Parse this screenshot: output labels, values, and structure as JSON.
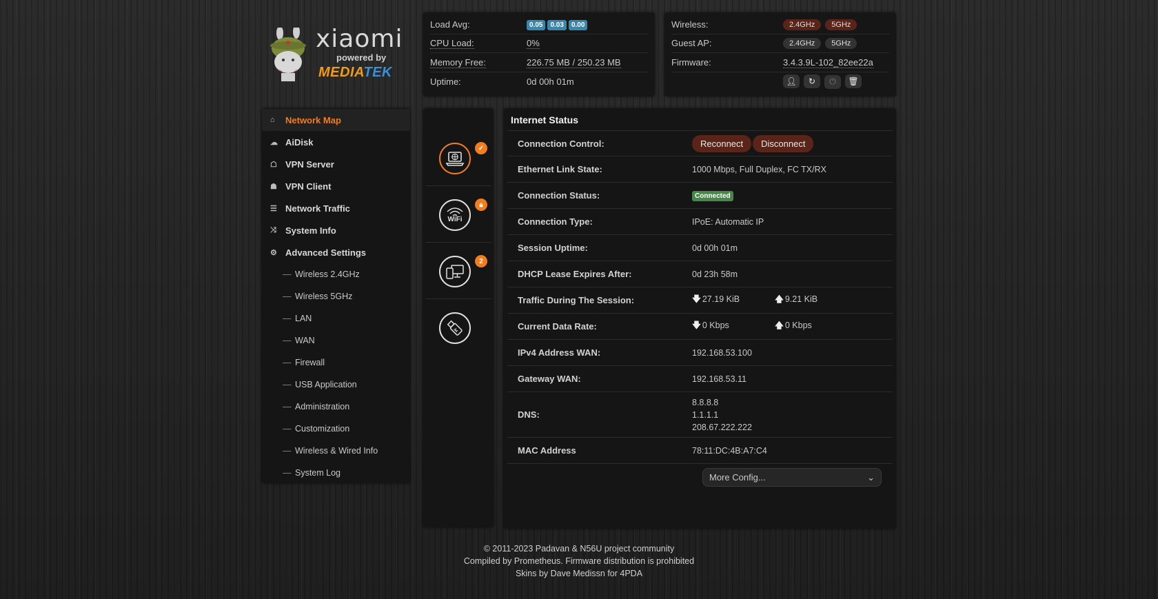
{
  "logo": {
    "brand": "xiaomi",
    "powered": "powered by",
    "mediatek_a": "MEDIA",
    "mediatek_b": "TEK"
  },
  "system": {
    "load_avg_label": "Load Avg:",
    "load_avg": [
      "0.05",
      "0.03",
      "0.00"
    ],
    "cpu_label": "CPU Load:",
    "cpu_value": "0%",
    "mem_label": "Memory Free:",
    "mem_value": "226.75 MB / 250.23 MB",
    "uptime_label": "Uptime:",
    "uptime_value": "0d 00h 01m"
  },
  "wireless": {
    "wireless_label": "Wireless:",
    "wireless_24": "2.4GHz",
    "wireless_5": "5GHz",
    "guest_label": "Guest AP:",
    "guest_24": "2.4GHz",
    "guest_5": "5GHz",
    "firmware_label": "Firmware:",
    "firmware_value": "3.4.3.9L-102_82ee22a"
  },
  "sidebar": {
    "items": [
      {
        "label": "Network Map",
        "icon": "home-icon"
      },
      {
        "label": "AiDisk",
        "icon": "cloud-icon"
      },
      {
        "label": "VPN Server",
        "icon": "server-icon"
      },
      {
        "label": "VPN Client",
        "icon": "client-icon"
      },
      {
        "label": "Network Traffic",
        "icon": "list-icon"
      },
      {
        "label": "System Info",
        "icon": "shuffle-icon"
      },
      {
        "label": "Advanced Settings",
        "icon": "gear-icon"
      }
    ],
    "subitems": [
      "Wireless 2.4GHz",
      "Wireless 5GHz",
      "LAN",
      "WAN",
      "Firewall",
      "USB Application",
      "Administration",
      "Customization",
      "Wireless & Wired Info",
      "System Log"
    ]
  },
  "icons": {
    "wifi_text": "WiFi",
    "clients_count": "2"
  },
  "main": {
    "title": "Internet Status",
    "conn_control_label": "Connection Control:",
    "reconnect": "Reconnect",
    "disconnect": "Disconnect",
    "eth_label": "Ethernet Link State:",
    "eth_value": "1000 Mbps, Full Duplex, FC TX/RX",
    "status_label": "Connection Status:",
    "status_value": "Connected",
    "type_label": "Connection Type:",
    "type_value": "IPoE: Automatic IP",
    "session_label": "Session Uptime:",
    "session_value": "0d 00h 01m",
    "dhcp_label": "DHCP Lease Expires After:",
    "dhcp_value": "0d 23h 58m",
    "traffic_label": "Traffic During The Session:",
    "traffic_down": "27.19 KiB",
    "traffic_up": "9.21 KiB",
    "rate_label": "Current Data Rate:",
    "rate_down": "0 Kbps",
    "rate_up": "0 Kbps",
    "ipv4_label": "IPv4 Address WAN:",
    "ipv4_value": "192.168.53.100",
    "gw_label": "Gateway WAN:",
    "gw_value": "192.168.53.11",
    "dns_label": "DNS:",
    "dns": [
      "8.8.8.8",
      "1.1.1.1",
      "208.67.222.222"
    ],
    "mac_label": "MAC Address",
    "mac_value": "78:11:DC:4B:A7:C4",
    "more_config": "More Config..."
  },
  "footer": {
    "line1": "© 2011-2023 Padavan & N56U project community",
    "line2": "Compiled by Prometheus. Firmware distribution is prohibited",
    "line3": "Skins by Dave Medissn for 4PDA"
  },
  "colors": {
    "accent": "#f07d1e",
    "badge_blue": "#3a87ad",
    "badge_green": "#468847",
    "btn_red": "#5b2419"
  }
}
